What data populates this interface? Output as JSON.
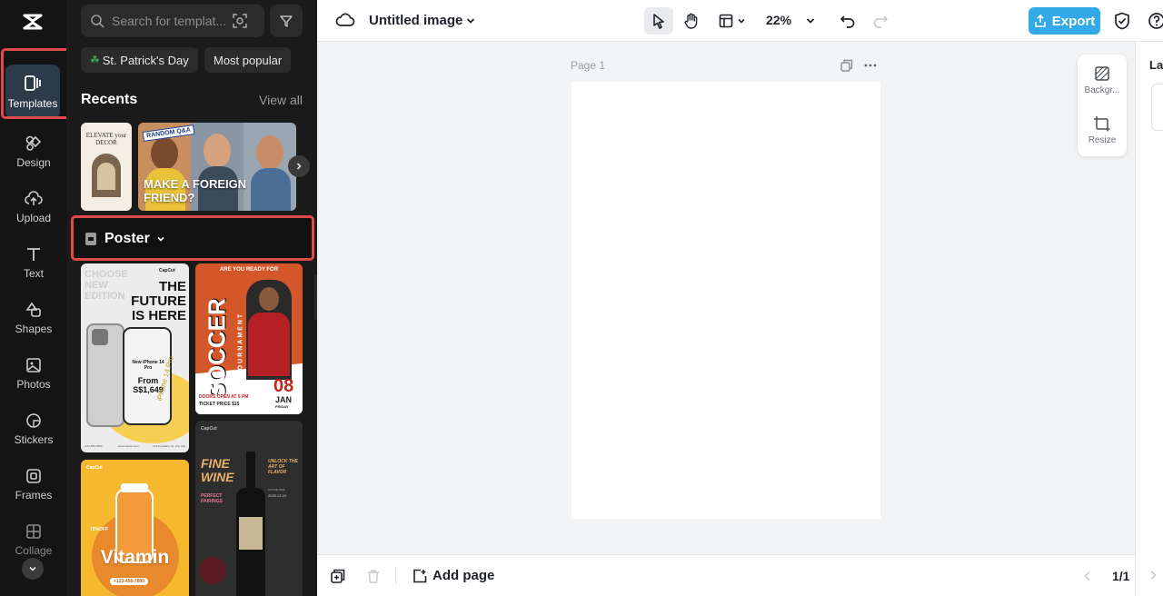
{
  "app": {
    "name": "CapCut",
    "accent_color": "#34a9e8",
    "highlight_color": "#e24a4a"
  },
  "rail": {
    "items": [
      {
        "label": "Templates",
        "icon": "templates-icon",
        "active": true
      },
      {
        "label": "Design",
        "icon": "design-icon"
      },
      {
        "label": "Upload",
        "icon": "cloud-upload-icon"
      },
      {
        "label": "Text",
        "icon": "text-icon"
      },
      {
        "label": "Shapes",
        "icon": "shapes-icon"
      },
      {
        "label": "Photos",
        "icon": "photo-icon"
      },
      {
        "label": "Stickers",
        "icon": "sticker-icon"
      },
      {
        "label": "Frames",
        "icon": "frame-icon"
      },
      {
        "label": "Collage",
        "icon": "collage-icon"
      }
    ]
  },
  "panel": {
    "search_placeholder": "Search for templat...",
    "chips": [
      "St. Patrick's Day",
      "Most popular"
    ],
    "recents_title": "Recents",
    "view_all": "View all",
    "recents": [
      {
        "title": "ELEVATE your DECOR"
      },
      {
        "tag": "RANDOM Q&A",
        "title": "MAKE A FOREIGN FRIEND?"
      }
    ],
    "category": "Poster",
    "templates": [
      {
        "brand": "CapCut",
        "faded": "CHOOSE NEW EDITION",
        "headline": "THE FUTURE IS HERE",
        "product": "New iPhone 14 Pro",
        "price_label": "From",
        "price": "S$1,649",
        "side_text": "iPhone 14 Pro",
        "footer_left": "+123-456-7890",
        "footer_mid": "www.capcut.com",
        "footer_right": "123 Anywhere St., Any City"
      },
      {
        "kicker": "ARE YOU READY FOR",
        "title": "SOCCER",
        "subtitle": "TOURNAMENT",
        "doors": "DOORS OPEN AT 5 PM",
        "ticket": "TICKET PRICE $15",
        "day": "08",
        "month": "JAN",
        "weekday": "FRIDAY"
      },
      {
        "brand": "CapCut",
        "badge": "15%OFF",
        "title": "Vitamin",
        "phone": "+123-456-7890"
      },
      {
        "brand": "CapCut",
        "title": "FINE WINE",
        "subtitle": "PERFECT PAIRINGS",
        "tagline": "UNLOCK THE ART OF FLAVOR",
        "active_label": "ACTIVE TIME",
        "date": "2025.12.24"
      }
    ]
  },
  "topbar": {
    "title": "Untitled image",
    "zoom": "22%",
    "export_label": "Export"
  },
  "canvas": {
    "page_label": "Page 1"
  },
  "float_panel": {
    "items": [
      "Backgr...",
      "Resize"
    ]
  },
  "right_panel": {
    "title": "La"
  },
  "bottombar": {
    "add_page": "Add page",
    "page_count": "1/1"
  }
}
